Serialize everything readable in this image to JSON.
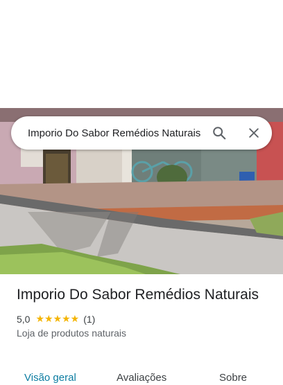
{
  "search": {
    "query": "Imporio Do Sabor Remédios Naturais",
    "search_icon": "search-icon",
    "close_icon": "close-icon"
  },
  "place": {
    "name": "Imporio Do Sabor Remédios Naturais",
    "rating": "5,0",
    "stars": "★★★★★",
    "review_count": "(1)",
    "category": "Loja de produtos naturais"
  },
  "tabs": [
    {
      "label": "Visão geral",
      "active": true
    },
    {
      "label": "Avaliações",
      "active": false
    },
    {
      "label": "Sobre",
      "active": false
    }
  ],
  "colors": {
    "accent": "#0b7ca1",
    "star": "#f4b400"
  }
}
